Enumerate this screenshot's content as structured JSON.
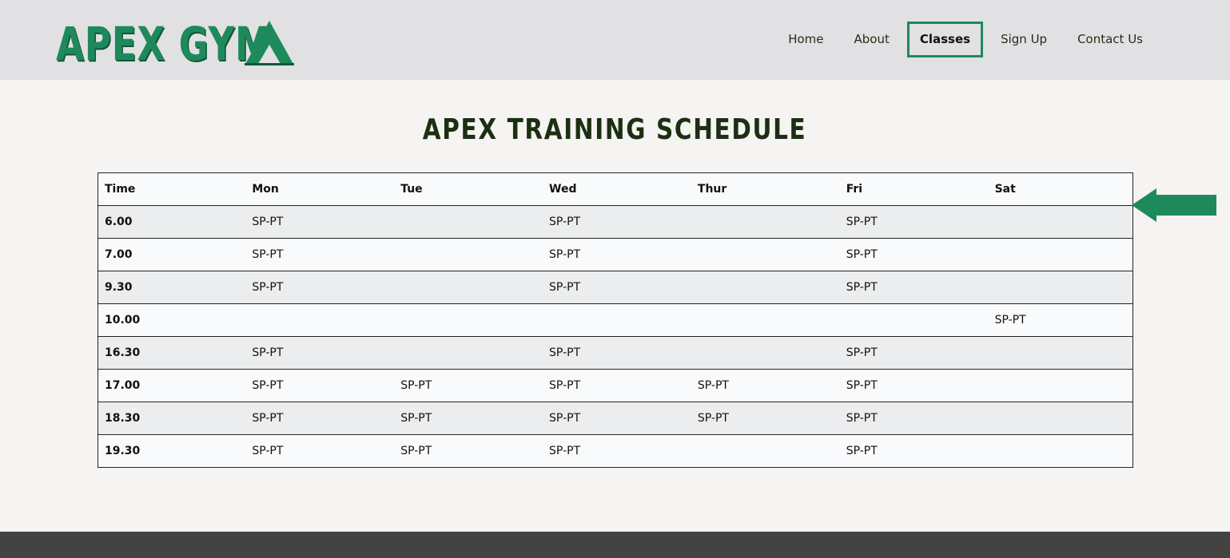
{
  "brand": {
    "name": "APEX GYM",
    "logo_icon": "mountain-icon",
    "accent_color": "#1e8a5c"
  },
  "nav": {
    "items": [
      {
        "label": "Home",
        "active": false
      },
      {
        "label": "About",
        "active": false
      },
      {
        "label": "Classes",
        "active": true
      },
      {
        "label": "Sign Up",
        "active": false
      },
      {
        "label": "Contact Us",
        "active": false
      }
    ]
  },
  "page": {
    "title": "APEX TRAINING SCHEDULE"
  },
  "schedule": {
    "headers": [
      "Time",
      "Mon",
      "Tue",
      "Wed",
      "Thur",
      "Fri",
      "Sat"
    ],
    "rows": [
      [
        "6.00",
        "SP-PT",
        "",
        "SP-PT",
        "",
        "SP-PT",
        ""
      ],
      [
        "7.00",
        "SP-PT",
        "",
        "SP-PT",
        "",
        "SP-PT",
        ""
      ],
      [
        "9.30",
        "SP-PT",
        "",
        "SP-PT",
        "",
        "SP-PT",
        ""
      ],
      [
        "10.00",
        "",
        "",
        "",
        "",
        "",
        "SP-PT"
      ],
      [
        "16.30",
        "SP-PT",
        "",
        "SP-PT",
        "",
        "SP-PT",
        ""
      ],
      [
        "17.00",
        "SP-PT",
        "SP-PT",
        "SP-PT",
        "SP-PT",
        "SP-PT",
        ""
      ],
      [
        "18.30",
        "SP-PT",
        "SP-PT",
        "SP-PT",
        "SP-PT",
        "SP-PT",
        ""
      ],
      [
        "19.30",
        "SP-PT",
        "SP-PT",
        "SP-PT",
        "",
        "SP-PT",
        ""
      ]
    ]
  },
  "decoration": {
    "arrow_icon": "arrow-left-icon",
    "arrow_color": "#1e8a5c"
  }
}
